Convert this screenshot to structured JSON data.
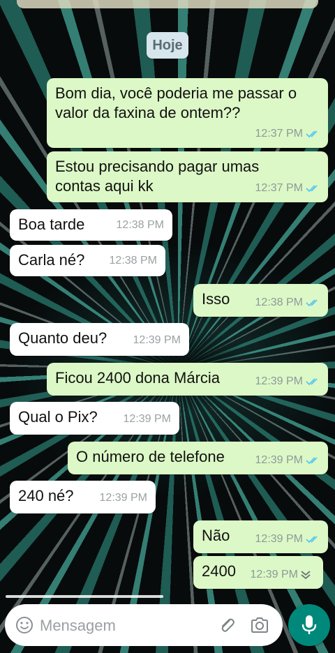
{
  "chat": {
    "date_label": "Hoje",
    "messages": [
      {
        "text": "Bom dia, você poderia me passar o valor da faxina de ontem??",
        "time": "12:37 PM"
      },
      {
        "text": "Estou precisando pagar umas contas aqui kk",
        "time": "12:37 PM"
      },
      {
        "text": "Boa tarde",
        "time": "12:38 PM"
      },
      {
        "text": "Carla né?",
        "time": "12:38 PM"
      },
      {
        "text": "Isso",
        "time": "12:38 PM"
      },
      {
        "text": "Quanto deu?",
        "time": "12:39 PM"
      },
      {
        "text": "Ficou 2400 dona Márcia",
        "time": "12:39 PM"
      },
      {
        "text": "Qual o Pix?",
        "time": "12:39 PM"
      },
      {
        "text": "O número de telefone",
        "time": "12:39 PM"
      },
      {
        "text": "240 né?",
        "time": "12:39 PM"
      },
      {
        "text": "Não",
        "time": "12:39 PM"
      },
      {
        "text": "2400",
        "time": "12:39 PM"
      }
    ]
  },
  "composer": {
    "placeholder": "Mensagem"
  },
  "colors": {
    "outgoing_bubble": "#dcf8c6",
    "incoming_bubble": "#ffffff",
    "read_ticks": "#4fc3f7",
    "mic_button": "#00897b"
  },
  "icons": {
    "emoji": "emoji-icon",
    "attach": "paperclip-icon",
    "camera": "camera-icon",
    "mic": "microphone-icon",
    "ticks": "double-check-icon",
    "scroll": "chevron-down-icon"
  }
}
